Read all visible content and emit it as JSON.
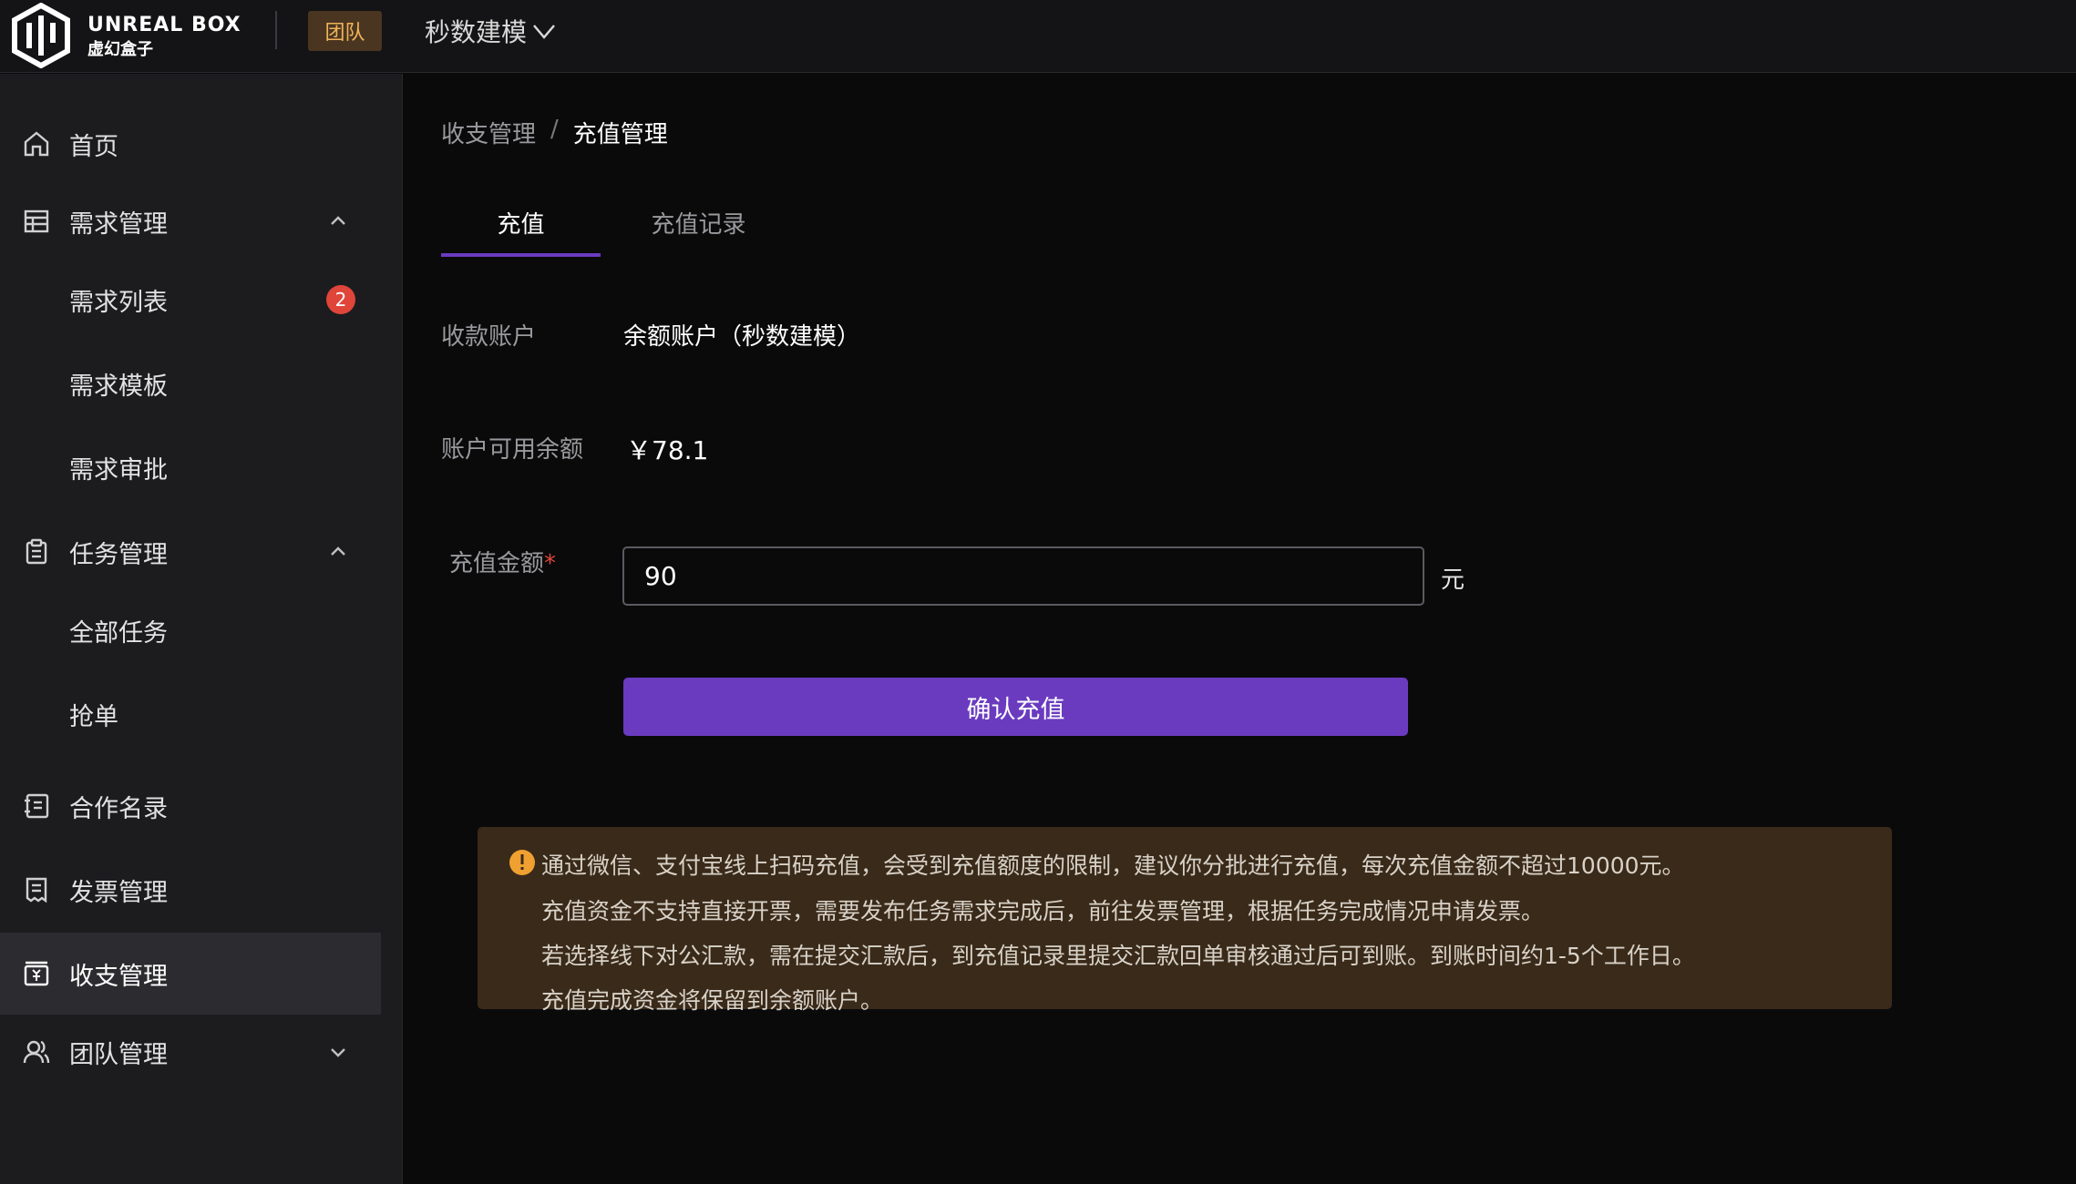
{
  "header": {
    "brand_en": "UNREAL BOX",
    "brand_cn": "虚幻盒子",
    "team_badge": "团队",
    "team_name": "秒数建模"
  },
  "sidebar": {
    "items": [
      {
        "label": "首页",
        "icon": "home-icon"
      },
      {
        "label": "需求管理",
        "icon": "table-icon",
        "expanded": true
      },
      {
        "label": "需求列表",
        "badge": "2"
      },
      {
        "label": "需求模板"
      },
      {
        "label": "需求审批"
      },
      {
        "label": "任务管理",
        "icon": "clipboard-icon",
        "expanded": true
      },
      {
        "label": "全部任务"
      },
      {
        "label": "抢单"
      },
      {
        "label": "合作名录",
        "icon": "contacts-icon"
      },
      {
        "label": "发票管理",
        "icon": "invoice-icon"
      },
      {
        "label": "收支管理",
        "icon": "wallet-icon",
        "active": true
      },
      {
        "label": "团队管理",
        "icon": "users-icon",
        "expanded": false
      }
    ]
  },
  "breadcrumb": {
    "parent": "收支管理",
    "separator": "/",
    "current": "充值管理"
  },
  "tabs": [
    {
      "label": "充值",
      "active": true
    },
    {
      "label": "充值记录",
      "active": false
    }
  ],
  "form": {
    "account_label": "收款账户",
    "account_value": "余额账户（秒数建模）",
    "balance_label": "账户可用余额",
    "balance_value": "￥78.1",
    "amount_label": "充值金额",
    "required_mark": "*",
    "amount_value": "90",
    "unit": "元",
    "confirm_label": "确认充值"
  },
  "notice": {
    "lines": [
      "通过微信、支付宝线上扫码充值，会受到充值额度的限制，建议你分批进行充值，每次充值金额不超过10000元。",
      "充值资金不支持直接开票，需要发布任务需求完成后，前往发票管理，根据任务完成情况申请发票。",
      "若选择线下对公汇款，需在提交汇款后，到充值记录里提交汇款回单审核通过后可到账。到账时间约1-5个工作日。",
      "充值完成资金将保留到余额账户。"
    ]
  },
  "colors": {
    "accent": "#6a3bbf",
    "badge_red": "#e0453a",
    "team_badge_text": "#f0b45a",
    "notice_bg": "#3a2a1a",
    "warning_icon": "#f0a030"
  }
}
